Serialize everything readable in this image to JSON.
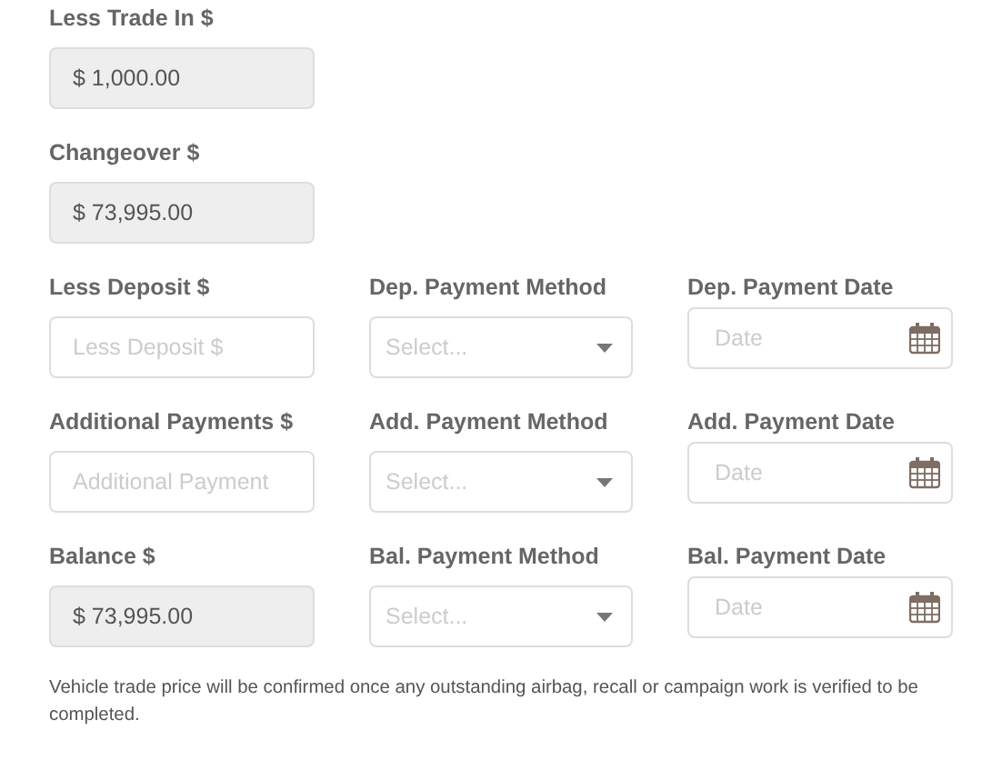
{
  "rows": [
    {
      "fields": [
        {
          "kind": "readonly",
          "label": "Less Trade In $",
          "value": "$ 1,000.00"
        }
      ]
    },
    {
      "fields": [
        {
          "kind": "readonly",
          "label": "Changeover $",
          "value": "$ 73,995.00"
        }
      ]
    },
    {
      "fields": [
        {
          "kind": "text",
          "label": "Less Deposit $",
          "placeholder": "Less Deposit $"
        },
        {
          "kind": "select",
          "label": "Dep. Payment Method",
          "placeholder": "Select..."
        },
        {
          "kind": "date",
          "label": "Dep. Payment Date",
          "placeholder": "Date"
        }
      ]
    },
    {
      "fields": [
        {
          "kind": "text",
          "label": "Additional Payments $",
          "placeholder": "Additional Payment"
        },
        {
          "kind": "select",
          "label": "Add. Payment Method",
          "placeholder": "Select..."
        },
        {
          "kind": "date",
          "label": "Add. Payment Date",
          "placeholder": "Date"
        }
      ]
    },
    {
      "fields": [
        {
          "kind": "readonly",
          "label": "Balance $",
          "value": "$ 73,995.00"
        },
        {
          "kind": "select",
          "label": "Bal. Payment Method",
          "placeholder": "Select..."
        },
        {
          "kind": "date",
          "label": "Bal. Payment Date",
          "placeholder": "Date"
        }
      ]
    }
  ],
  "note": "Vehicle trade price will be confirmed once any outstanding airbag, recall or campaign work is verified to be completed."
}
